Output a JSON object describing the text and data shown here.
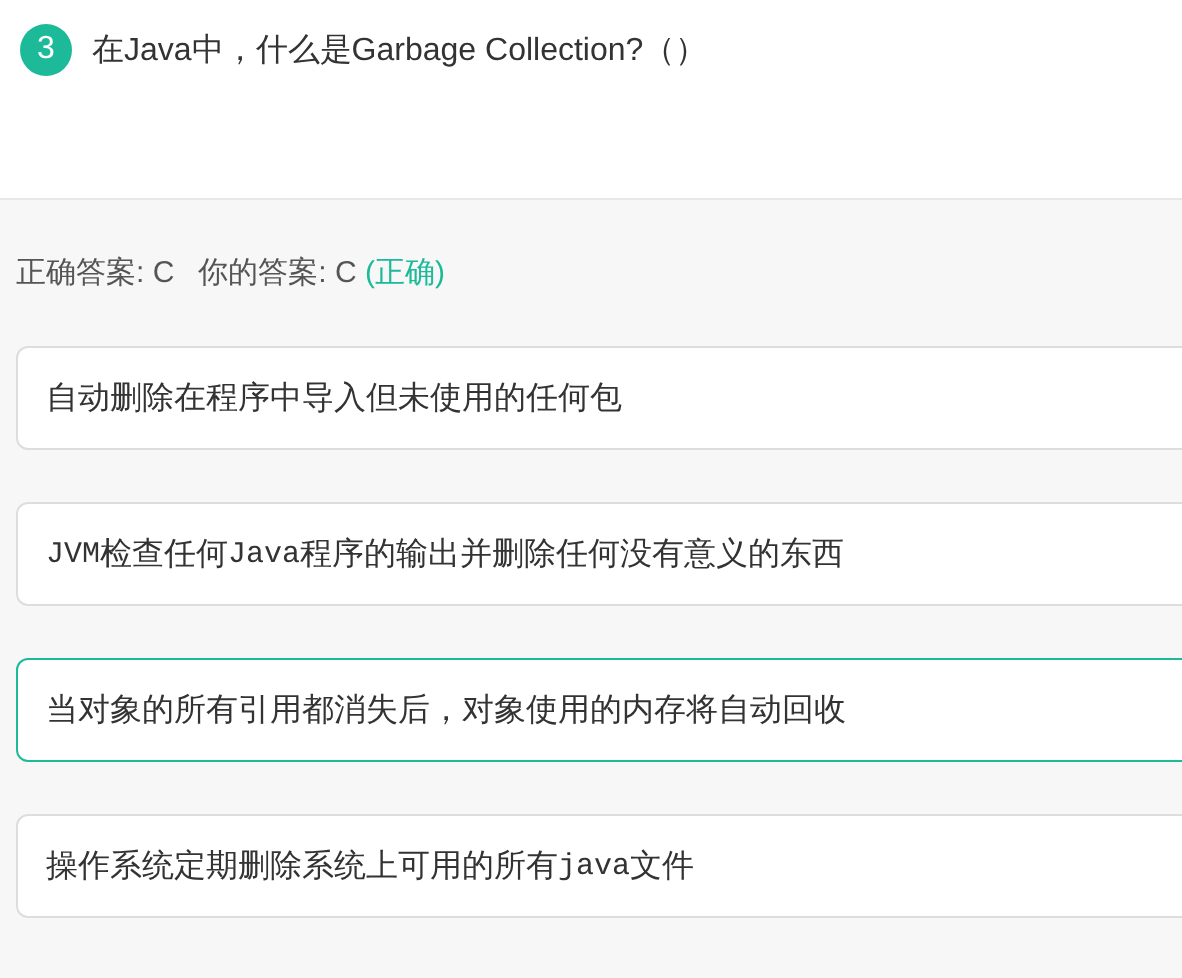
{
  "question": {
    "number": "3",
    "text": "在Java中，什么是Garbage Collection?（）"
  },
  "result": {
    "correct_label": "正确答案: C",
    "your_label": "你的答案: C",
    "verdict": "(正确)"
  },
  "options": [
    {
      "selected": false,
      "parts": [
        {
          "kind": "plain",
          "text": "自动删除在程序中导入但未使用的任何包"
        }
      ]
    },
    {
      "selected": false,
      "parts": [
        {
          "kind": "code",
          "text": "JVM"
        },
        {
          "kind": "plain",
          "text": "检查任何"
        },
        {
          "kind": "code",
          "text": "Java"
        },
        {
          "kind": "plain",
          "text": "程序的输出并删除任何没有意义的东西"
        }
      ]
    },
    {
      "selected": true,
      "parts": [
        {
          "kind": "plain",
          "text": "当对象的所有引用都消失后，对象使用的内存将自动回收"
        }
      ]
    },
    {
      "selected": false,
      "parts": [
        {
          "kind": "plain",
          "text": "操作系统定期删除系统上可用的所有"
        },
        {
          "kind": "code",
          "text": "java"
        },
        {
          "kind": "plain",
          "text": "文件"
        }
      ]
    }
  ]
}
